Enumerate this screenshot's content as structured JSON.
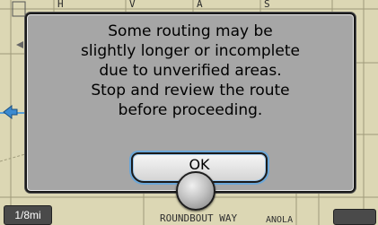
{
  "map": {
    "scale_label": "1/8mi",
    "road_label": "ROUNDBOUT WAY",
    "road_label_2": "ANOLA",
    "top_labels": [
      "H",
      "V",
      "A",
      "S"
    ]
  },
  "dialog": {
    "message_lines": [
      "Some routing may be",
      "slightly longer or incomplete",
      "due to unverified areas.",
      "Stop and review the route",
      "before proceeding."
    ],
    "ok_label": "OK"
  },
  "colors": {
    "map_background": "#dcd7b4",
    "dialog_background": "#a6a6a6",
    "button_highlight": "#6aa6d8"
  },
  "icons": {
    "nav_arrow": "left-arrow-icon",
    "knob": "selector-knob-icon"
  }
}
